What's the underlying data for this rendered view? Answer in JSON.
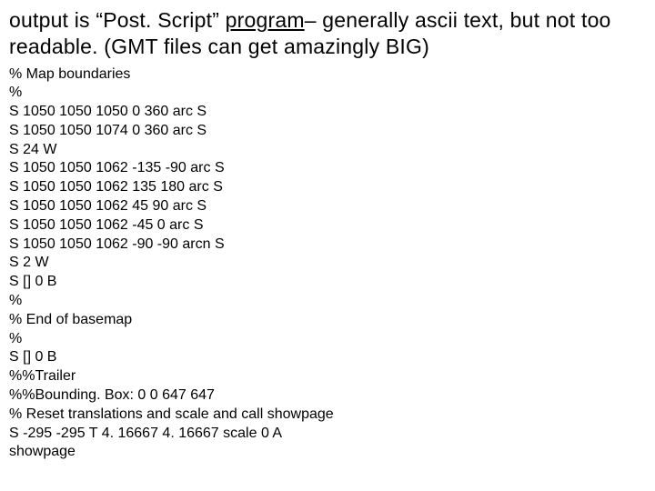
{
  "heading": {
    "prefix": "output is “Post. Script” ",
    "underlined_word": "program",
    "suffix": "– generally ascii text, but not too readable. (GMT files can get amazingly BIG)"
  },
  "code_lines": [
    "% Map boundaries",
    "%",
    "S 1050 1050 1050 0 360 arc S",
    "S 1050 1050 1074 0 360 arc S",
    "S 24 W",
    "S 1050 1050 1062 -135 -90 arc S",
    "S 1050 1050 1062 135 180 arc S",
    "S 1050 1050 1062 45 90 arc S",
    "S 1050 1050 1062 -45 0 arc S",
    "S 1050 1050 1062 -90 -90 arcn S",
    "S 2 W",
    "S [] 0 B",
    "%",
    "% End of basemap",
    "%",
    "S [] 0 B",
    "%%Trailer",
    "%%Bounding. Box: 0 0 647 647",
    "% Reset translations and scale and call showpage",
    "S -295 -295 T 4. 16667 4. 16667 scale 0 A",
    "showpage"
  ]
}
